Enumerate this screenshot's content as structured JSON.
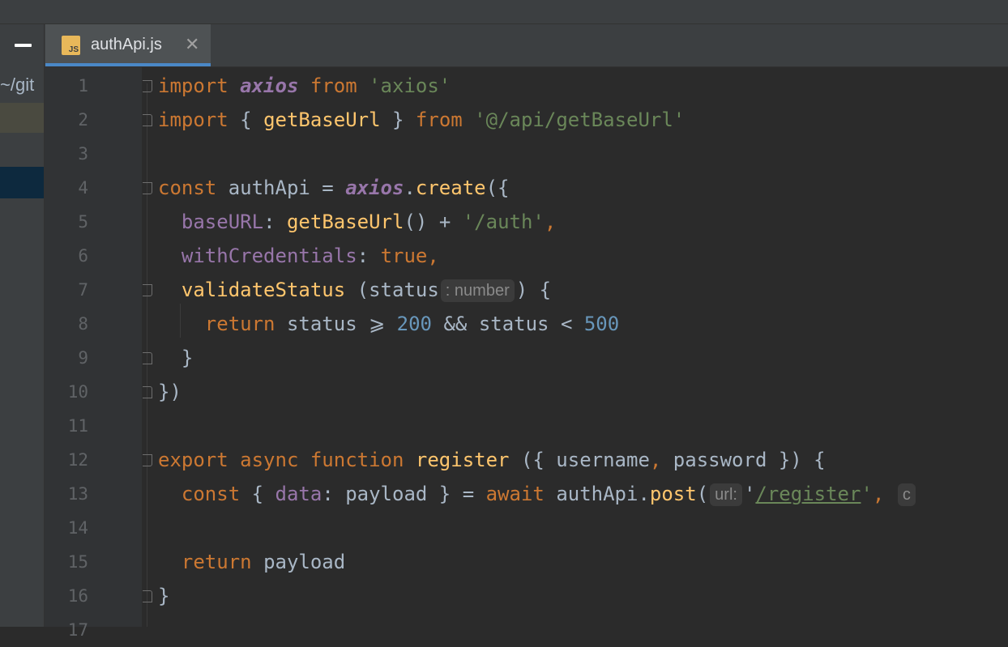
{
  "sidebar": {
    "path_fragment": "~/git"
  },
  "tab": {
    "title": "authApi.js",
    "icon_text": "JS",
    "close_glyph": "✕"
  },
  "line_numbers": [
    "1",
    "2",
    "3",
    "4",
    "5",
    "6",
    "7",
    "8",
    "9",
    "10",
    "11",
    "12",
    "13",
    "14",
    "15",
    "16",
    "17"
  ],
  "code_lines": [
    [
      {
        "t": "import ",
        "c": "kw"
      },
      {
        "t": "axios",
        "c": "italic"
      },
      {
        "t": " from ",
        "c": "kw"
      },
      {
        "t": "'axios'",
        "c": "str"
      }
    ],
    [
      {
        "t": "import ",
        "c": "kw"
      },
      {
        "t": "{ "
      },
      {
        "t": "getBaseUrl",
        "c": "fn"
      },
      {
        "t": " } "
      },
      {
        "t": "from ",
        "c": "kw"
      },
      {
        "t": "'@/api/getBaseUrl'",
        "c": "str"
      }
    ],
    [],
    [
      {
        "t": "const ",
        "c": "kw"
      },
      {
        "t": "authApi = "
      },
      {
        "t": "axios",
        "c": "italic"
      },
      {
        "t": "."
      },
      {
        "t": "create",
        "c": "fn"
      },
      {
        "t": "({"
      }
    ],
    [
      {
        "t": "  "
      },
      {
        "t": "baseURL",
        "c": "prop"
      },
      {
        "t": ": "
      },
      {
        "t": "getBaseUrl",
        "c": "fn"
      },
      {
        "t": "() + "
      },
      {
        "t": "'/auth'",
        "c": "str"
      },
      {
        "t": ",",
        "c": "kw"
      }
    ],
    [
      {
        "t": "  "
      },
      {
        "t": "withCredentials",
        "c": "prop"
      },
      {
        "t": ": "
      },
      {
        "t": "true,",
        "c": "kw"
      }
    ],
    [
      {
        "t": "  "
      },
      {
        "t": "validateStatus",
        "c": "fn"
      },
      {
        "t": " (status"
      },
      {
        "t": ": number",
        "c": "hint"
      },
      {
        "t": ") {"
      }
    ],
    [
      {
        "t": "    "
      },
      {
        "t": "return ",
        "c": "kw"
      },
      {
        "t": "status ⩾ "
      },
      {
        "t": "200",
        "c": "num"
      },
      {
        "t": " && status < "
      },
      {
        "t": "500",
        "c": "num"
      }
    ],
    [
      {
        "t": "  }"
      }
    ],
    [
      {
        "t": "})"
      }
    ],
    [],
    [
      {
        "t": "export ",
        "c": "kw"
      },
      {
        "t": "async ",
        "c": "kw"
      },
      {
        "t": "function ",
        "c": "kw"
      },
      {
        "t": "register",
        "c": "fn"
      },
      {
        "t": " ({ username"
      },
      {
        "t": ",",
        "c": "kw"
      },
      {
        "t": " password }) {"
      }
    ],
    [
      {
        "t": "  "
      },
      {
        "t": "const ",
        "c": "kw"
      },
      {
        "t": "{ "
      },
      {
        "t": "data",
        "c": "prop"
      },
      {
        "t": ": payload } = "
      },
      {
        "t": "await ",
        "c": "kw"
      },
      {
        "t": "authApi."
      },
      {
        "t": "post",
        "c": "fn"
      },
      {
        "t": "("
      },
      {
        "t": "url:",
        "c": "hint"
      },
      {
        "t": "'"
      },
      {
        "t": "/register",
        "c": "strlink"
      },
      {
        "t": "'",
        "c": "str"
      },
      {
        "t": ", ",
        "c": "kw"
      },
      {
        "t": "c",
        "c": "hint"
      }
    ],
    [],
    [
      {
        "t": "  "
      },
      {
        "t": "return ",
        "c": "kw"
      },
      {
        "t": "payload"
      }
    ],
    [
      {
        "t": "}"
      }
    ],
    []
  ],
  "colors": {
    "background": "#2b2b2b",
    "keyword": "#cc7832",
    "string": "#6a8759",
    "function": "#ffc66d",
    "property": "#9876aa",
    "number": "#6897bb",
    "tab_accent": "#4a88c7"
  }
}
